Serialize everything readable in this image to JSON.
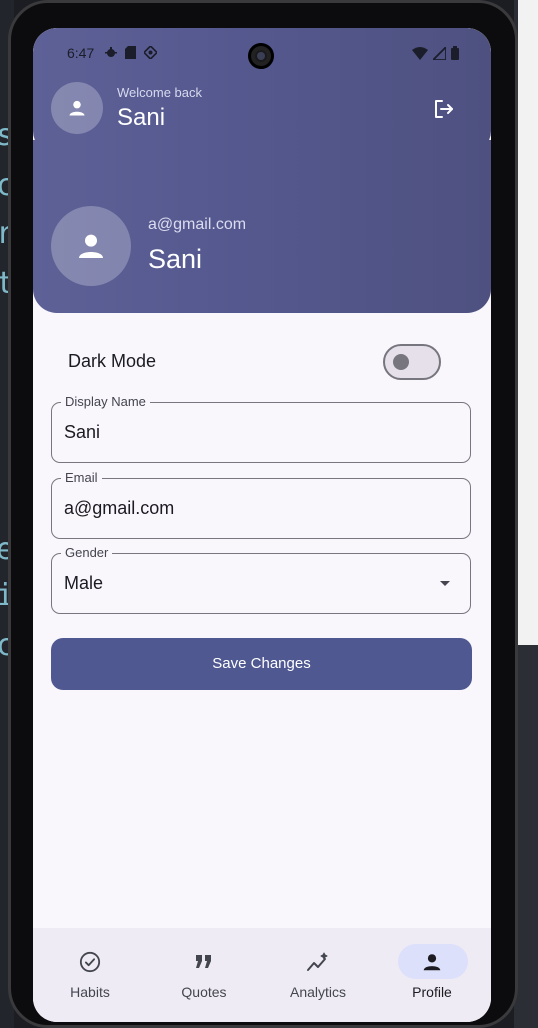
{
  "status_bar": {
    "time": "6:47"
  },
  "header": {
    "welcome_label": "Welcome back",
    "user_name": "Sani"
  },
  "profile_card": {
    "email": "a@gmail.com",
    "name": "Sani"
  },
  "settings": {
    "dark_mode_label": "Dark Mode",
    "dark_mode_enabled": false
  },
  "form": {
    "display_name": {
      "label": "Display Name",
      "value": "Sani"
    },
    "email": {
      "label": "Email",
      "value": "a@gmail.com"
    },
    "gender": {
      "label": "Gender",
      "value": "Male"
    },
    "save_label": "Save Changes"
  },
  "bottom_nav": {
    "items": [
      {
        "label": "Habits",
        "icon": "check-circle-icon",
        "active": false
      },
      {
        "label": "Quotes",
        "icon": "quote-icon",
        "active": false
      },
      {
        "label": "Analytics",
        "icon": "analytics-icon",
        "active": false
      },
      {
        "label": "Profile",
        "icon": "person-icon",
        "active": true
      }
    ]
  },
  "colors": {
    "header_gradient_start": "#5d6196",
    "header_gradient_end": "#4e5180",
    "primary_button": "#4f5891",
    "active_nav_pill": "#dde0fb",
    "background": "#f9f6fc"
  }
}
